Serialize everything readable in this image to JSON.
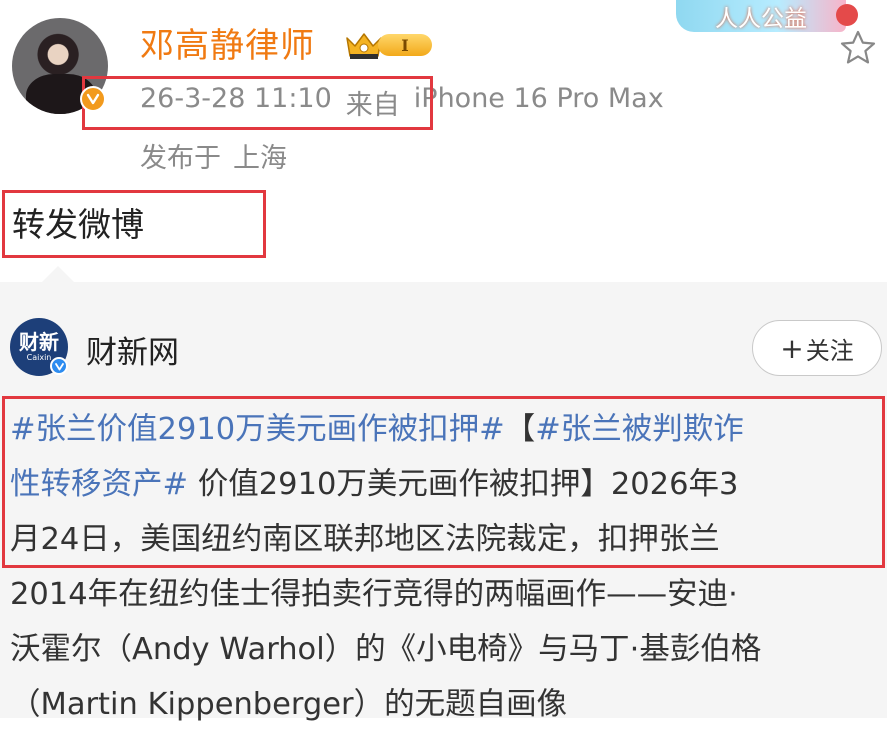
{
  "author": {
    "name": "邓高静律师",
    "member_level": "I"
  },
  "banner": {
    "text": "人人公益"
  },
  "post": {
    "timestamp": "26-3-28 11:10",
    "source_prefix": "来自",
    "device": "iPhone 16 Pro Max",
    "location_prefix": "发布于",
    "location": "上海",
    "repost_text": "转发微博"
  },
  "quoted": {
    "source_logo_text": "财新",
    "source_logo_subtext": "Caixin",
    "source_name": "财新网",
    "follow_label": "关注",
    "lines": [
      [
        {
          "text": "#张兰价值2910万美元画作被扣押#",
          "type": "hashtag"
        },
        {
          "text": "【",
          "type": "text"
        },
        {
          "text": "#张兰被判欺诈",
          "type": "hashtag"
        }
      ],
      [
        {
          "text": "性转移资产#",
          "type": "hashtag"
        },
        {
          "text": " 价值2910万美元画作被扣押】2026年3",
          "type": "text"
        }
      ],
      [
        {
          "text": "月24日，美国纽约南区联邦地区法院裁定，扣押张兰",
          "type": "text"
        }
      ],
      [
        {
          "text": "2014年在纽约佳士得拍卖行竞得的两幅画作——安迪·",
          "type": "text"
        }
      ],
      [
        {
          "text": "沃霍尔（Andy Warhol）的《小电椅》与马丁·基彭伯格",
          "type": "text"
        }
      ],
      [
        {
          "text": "（Martin Kippenberger）的无题自画像",
          "type": "text"
        }
      ]
    ]
  },
  "colors": {
    "name_orange": "#f07a12",
    "meta_gray": "#8a8a8a",
    "hashtag_blue": "#4a74b9",
    "highlight_red": "#e2383f",
    "card_bg": "#f5f5f5"
  }
}
